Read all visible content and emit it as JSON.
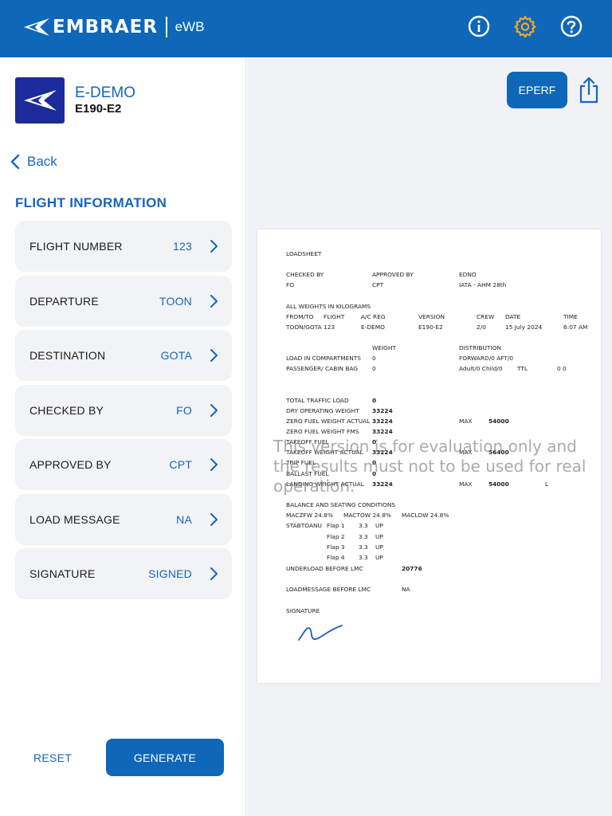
{
  "header": {
    "brand": "EMBRAER",
    "app": "eWB",
    "icons": [
      "info-icon",
      "settings-gear-icon",
      "help-icon"
    ],
    "colors": {
      "bar": "#0f67b8",
      "gear": "#f5a623"
    }
  },
  "aircraft": {
    "name": "E-DEMO",
    "type": "E190-E2"
  },
  "nav": {
    "back": "Back"
  },
  "flight_info": {
    "title": "FLIGHT INFORMATION",
    "rows": [
      {
        "label": "FLIGHT NUMBER",
        "value": "123"
      },
      {
        "label": "DEPARTURE",
        "value": "TOON"
      },
      {
        "label": "DESTINATION",
        "value": "GOTA"
      },
      {
        "label": "CHECKED BY",
        "value": "FO"
      },
      {
        "label": "APPROVED BY",
        "value": "CPT"
      },
      {
        "label": "LOAD MESSAGE",
        "value": "NA"
      },
      {
        "label": "SIGNATURE",
        "value": "SIGNED"
      }
    ]
  },
  "actions": {
    "reset": "RESET",
    "generate": "GENERATE",
    "eperf": "EPERF"
  },
  "loadsheet": {
    "title": "LOADSHEET",
    "checked_by_label": "CHECKED BY",
    "checked_by": "FO",
    "approved_by_label": "APPROVED BY",
    "approved_by": "CPT",
    "edno_label": "EDNO",
    "edno": "IATA - AHM 28th",
    "weights_note": "ALL WEIGHTS IN KILOGRAMS",
    "hdr": {
      "from_to": "FROM/TO",
      "flight": "FLIGHT",
      "ac_reg": "A/C REG",
      "version": "VERSION",
      "crew": "CREW",
      "date": "DATE",
      "time": "TIME"
    },
    "vals": {
      "from_to": "TOON/GOTA",
      "flight": "123",
      "ac_reg": "E-DEMO",
      "version": "E190-E2",
      "crew": "2/0",
      "date": "15 July 2024",
      "time": "6:07 AM"
    },
    "weight_label": "WEIGHT",
    "distribution_label": "DISTRIBUTION",
    "load_comp_label": "LOAD IN COMPARTMENTS",
    "load_comp": "0",
    "load_comp_dist": "FORWARD/0 AFT/0",
    "pax_label": "PASSENGER/ CABIN BAG",
    "pax": "0",
    "pax_dist": "Adult/0 Child/0",
    "ttl_label": "TTL",
    "ttl": "0 0",
    "total_traffic_label": "TOTAL TRAFFIC LOAD",
    "total_traffic": "0",
    "dow_label": "DRY OPERATING WEIGHT",
    "dow": "33224",
    "zfw_label": "ZERO FUEL WEIGHT ACTUAL",
    "zfw": "33224",
    "zfw_max_label": "MAX",
    "zfw_max": "54000",
    "zfw_fms_label": "ZERO FUEL WEIGHT FMS",
    "zfw_fms": "33224",
    "to_fuel_label": "TAKEOFF FUEL",
    "to_fuel": "0",
    "tow_label": "TAKEOFF WEIGHT ACTUAL",
    "tow": "33224",
    "tow_max_label": "MAX",
    "tow_max": "56400",
    "trip_fuel_label": "TRIP FUEL",
    "trip_fuel": "0",
    "ballast_label": "BALLAST FUEL",
    "ballast": "0",
    "lw_label": "LANDING WEIGHT ACTUAL",
    "lw": "33224",
    "lw_max_label": "MAX",
    "lw_max": "54000",
    "lw_flag": "L",
    "balance_label": "BALANCE AND SEATING CONDITIONS",
    "maczfw": "MACZFW  24.8%",
    "mactow": "MACTOW  24.8%",
    "macldw": "MACLDW  24.8%",
    "stab_label": "STABTOANU",
    "flaps": [
      {
        "flap": "Flap 1",
        "val": "3.3",
        "dir": "UP"
      },
      {
        "flap": "Flap 2",
        "val": "3.3",
        "dir": "UP"
      },
      {
        "flap": "Flap 3",
        "val": "3.3",
        "dir": "UP"
      },
      {
        "flap": "Flap 4",
        "val": "3.3",
        "dir": "UP"
      }
    ],
    "underload_label": "UNDERLOAD BEFORE LMC",
    "underload": "20776",
    "lmc_label": "LOADMESSAGE BEFORE LMC",
    "lmc": "NA",
    "signature_label": "SIGNATURE",
    "watermark": [
      "This version is for evaluation only and",
      "the results must not to be used for real",
      "operation."
    ]
  }
}
